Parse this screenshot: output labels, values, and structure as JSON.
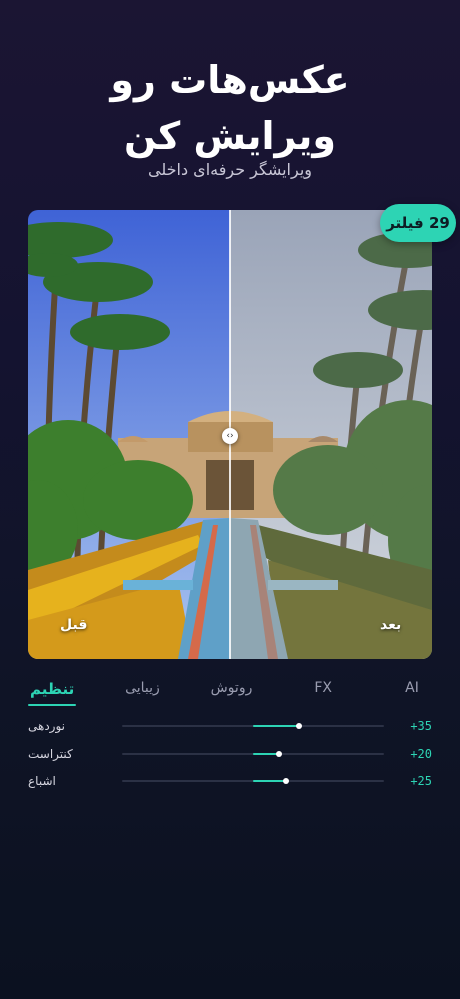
{
  "hero": {
    "title_line1": "عکس‌هات رو",
    "title_line2": "ویرایش کن",
    "subtitle": "ویرایشگر حرفه‌ای داخلی"
  },
  "photo": {
    "badge": "29 فیلتر",
    "before_label": "قبل",
    "after_label": "بعد"
  },
  "tabs": [
    {
      "label": "AI",
      "active": false
    },
    {
      "label": "FX",
      "active": false
    },
    {
      "label": "روتوش",
      "active": false
    },
    {
      "label": "زیبایی",
      "active": false
    },
    {
      "label": "تنظیم",
      "active": true
    }
  ],
  "sliders": [
    {
      "name": "نوردهی",
      "value": "+35",
      "level": 0.35
    },
    {
      "name": "کنتراست",
      "value": "+20",
      "level": 0.2
    },
    {
      "name": "اشباع",
      "value": "+25",
      "level": 0.25
    }
  ],
  "colors": {
    "accent": "#2dd4b4",
    "background": "#141330"
  }
}
